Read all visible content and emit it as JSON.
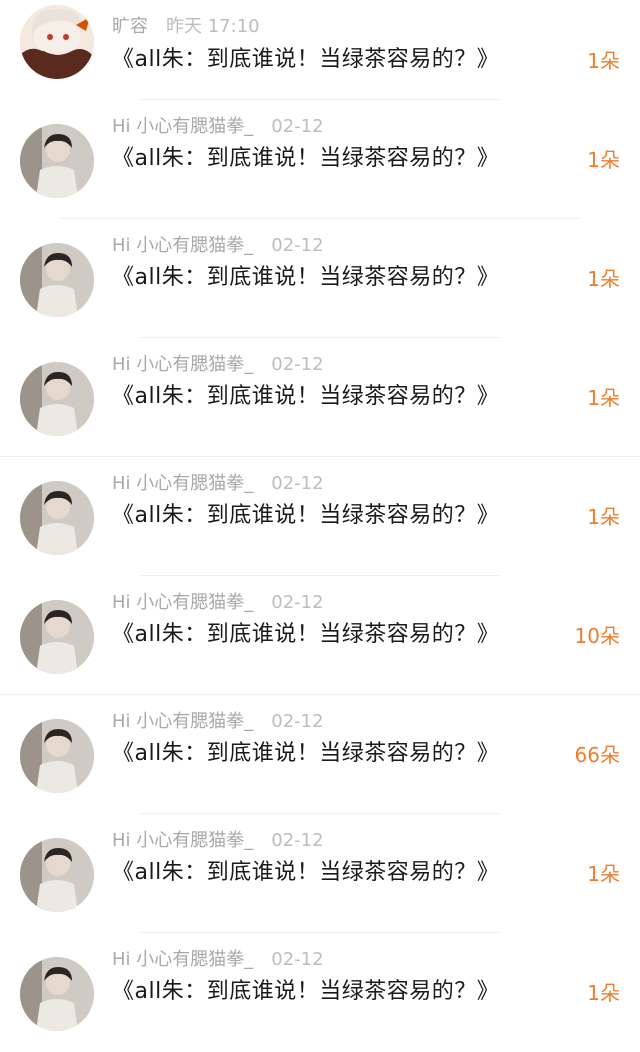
{
  "colors": {
    "gift_count": "#ef7d2d",
    "meta_text": "#a9a9a9",
    "title_text": "#1a1a1a",
    "divider": "#f1f1f1"
  },
  "items": [
    {
      "avatar": "anime-avatar-icon",
      "user": "旷容",
      "time": "昨天 17:10",
      "title": "《all朱：到底谁说！当绿茶容易的？》",
      "gift": "1朵"
    },
    {
      "avatar": "user-photo-avatar",
      "user": "Hi 小心有腮猫拳_",
      "time": "02-12",
      "title": "《all朱：到底谁说！当绿茶容易的？》",
      "gift": "1朵"
    },
    {
      "avatar": "user-photo-avatar",
      "user": "Hi 小心有腮猫拳_",
      "time": "02-12",
      "title": "《all朱：到底谁说！当绿茶容易的？》",
      "gift": "1朵"
    },
    {
      "avatar": "user-photo-avatar",
      "user": "Hi 小心有腮猫拳_",
      "time": "02-12",
      "title": "《all朱：到底谁说！当绿茶容易的？》",
      "gift": "1朵"
    },
    {
      "avatar": "user-photo-avatar",
      "user": "Hi 小心有腮猫拳_",
      "time": "02-12",
      "title": "《all朱：到底谁说！当绿茶容易的？》",
      "gift": "1朵"
    },
    {
      "avatar": "user-photo-avatar",
      "user": "Hi 小心有腮猫拳_",
      "time": "02-12",
      "title": "《all朱：到底谁说！当绿茶容易的？》",
      "gift": "10朵"
    },
    {
      "avatar": "user-photo-avatar",
      "user": "Hi 小心有腮猫拳_",
      "time": "02-12",
      "title": "《all朱：到底谁说！当绿茶容易的？》",
      "gift": "66朵"
    },
    {
      "avatar": "user-photo-avatar",
      "user": "Hi 小心有腮猫拳_",
      "time": "02-12",
      "title": "《all朱：到底谁说！当绿茶容易的？》",
      "gift": "1朵"
    },
    {
      "avatar": "user-photo-avatar",
      "user": "Hi 小心有腮猫拳_",
      "time": "02-12",
      "title": "《all朱：到底谁说！当绿茶容易的？》",
      "gift": "1朵"
    }
  ]
}
